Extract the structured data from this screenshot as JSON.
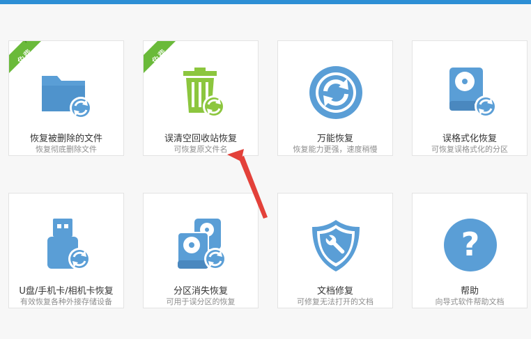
{
  "colors": {
    "topbar": "#2d8fd5",
    "icon_blue": "#5a9ed6",
    "icon_green": "#8cc63e",
    "ribbon_green": "#6aba3a",
    "arrow_red": "#e3413a"
  },
  "cards": [
    {
      "title": "恢复被删除的文件",
      "subtitle": "恢复彻底删除文件",
      "icon": "folder-recover-icon",
      "badge": "免费"
    },
    {
      "title": "误清空回收站恢复",
      "subtitle": "可恢复原文件名",
      "icon": "recycle-bin-recover-icon",
      "badge": "免费"
    },
    {
      "title": "万能恢复",
      "subtitle": "恢复能力更强，速度稍慢",
      "icon": "universal-recover-icon"
    },
    {
      "title": "误格式化恢复",
      "subtitle": "可恢复误格式化的分区",
      "icon": "format-recover-icon"
    },
    {
      "title": "U盘/手机卡/相机卡恢复",
      "subtitle": "有效恢复各种外接存储设备",
      "icon": "usb-recover-icon"
    },
    {
      "title": "分区消失恢复",
      "subtitle": "可用于误分区的恢复",
      "icon": "partition-recover-icon"
    },
    {
      "title": "文档修复",
      "subtitle": "可修复无法打开的文档",
      "icon": "document-repair-icon"
    },
    {
      "title": "帮助",
      "subtitle": "向导式软件帮助文档",
      "icon": "help-icon"
    }
  ]
}
